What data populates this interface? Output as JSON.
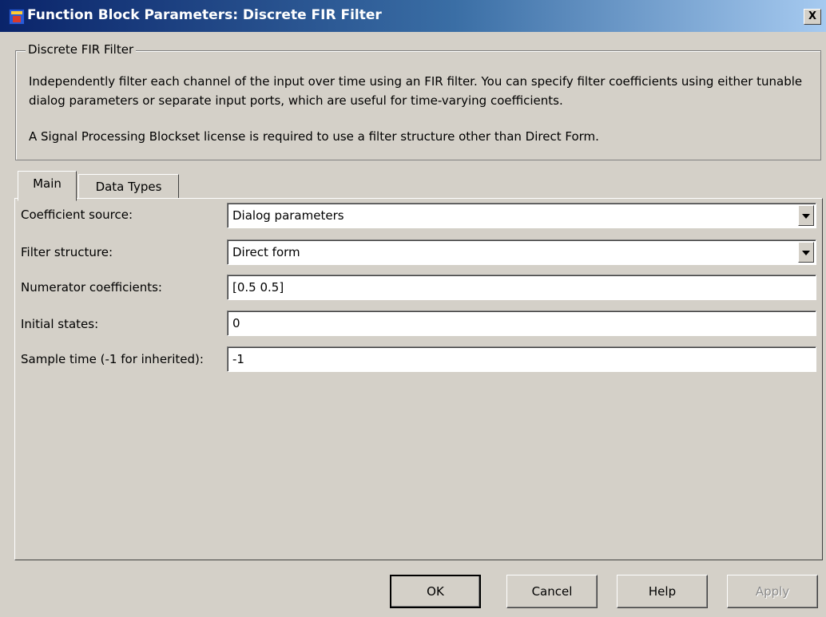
{
  "window": {
    "title": "Function Block Parameters: Discrete FIR Filter",
    "app_icon": "simulink-block-icon",
    "close_label": "X"
  },
  "description": {
    "group_title": "Discrete FIR Filter",
    "text": "Independently filter each channel of the input over time using an FIR filter. You can specify filter coefficients using either tunable dialog parameters or separate input ports, which are useful for time-varying coefficients.",
    "license_note": "A Signal Processing Blockset license is required to use a filter structure other than Direct Form."
  },
  "tabs": [
    {
      "label": "Main",
      "active": true
    },
    {
      "label": "Data Types",
      "active": false
    }
  ],
  "parameters": {
    "coefficient_source": {
      "label": "Coefficient source:",
      "value": "Dialog parameters"
    },
    "filter_structure": {
      "label": "Filter structure:",
      "value": "Direct form"
    },
    "numerator_coefficients": {
      "label": "Numerator coefficients:",
      "value": "[0.5 0.5]"
    },
    "initial_states": {
      "label": "Initial states:",
      "value": "0"
    },
    "sample_time": {
      "label": "Sample time (-1 for inherited):",
      "value": "-1"
    }
  },
  "buttons": {
    "ok": "OK",
    "cancel": "Cancel",
    "help": "Help",
    "apply": "Apply"
  },
  "colors": {
    "dialog_background": "#d4d0c8",
    "titlebar_start": "#0a246a",
    "titlebar_end": "#a6caf0",
    "disabled_text": "#8c8c8c"
  }
}
